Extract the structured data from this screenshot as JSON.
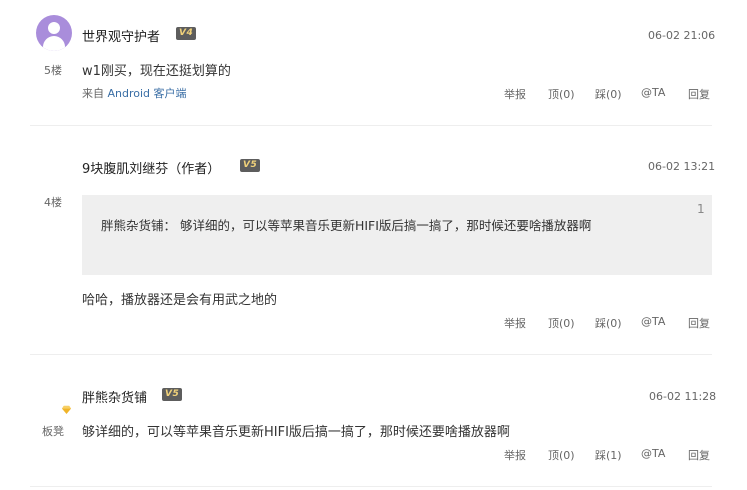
{
  "posts": [
    {
      "floor": "5楼",
      "username": "世界观守护者",
      "level": "V4",
      "time": "06-02 21:06",
      "content": "w1刚买，现在还挺划算的",
      "source_prefix": "来自",
      "source_link": "Android 客户端",
      "actions": [
        "举报",
        "顶(0)",
        "踩(0)",
        "@TA",
        "回复"
      ]
    },
    {
      "floor": "4楼",
      "username": "9块腹肌刘继芬（作者）",
      "level": "V5",
      "time": "06-02 13:21",
      "quote": {
        "text": "胖熊杂货铺：  够详细的，可以等苹果音乐更新HIFI版后搞一搞了，那时候还要啥播放器啊",
        "number": "1"
      },
      "content": "哈哈，播放器还是会有用武之地的",
      "actions": [
        "举报",
        "顶(0)",
        "踩(0)",
        "@TA",
        "回复"
      ]
    },
    {
      "floor": "板凳",
      "username": "胖熊杂货铺",
      "level": "V5",
      "time": "06-02 11:28",
      "content": "够详细的，可以等苹果音乐更新HIFI版后搞一搞了，那时候还要啥播放器啊",
      "actions": [
        "举报",
        "顶(0)",
        "踩(1)",
        "@TA",
        "回复"
      ]
    }
  ],
  "colors": {
    "avatar": "#a98ddb",
    "badge_bg": "#5d5d5d",
    "badge_text": "#f1d27a",
    "link": "#3a6ea5",
    "diamond": "#f0b429"
  }
}
